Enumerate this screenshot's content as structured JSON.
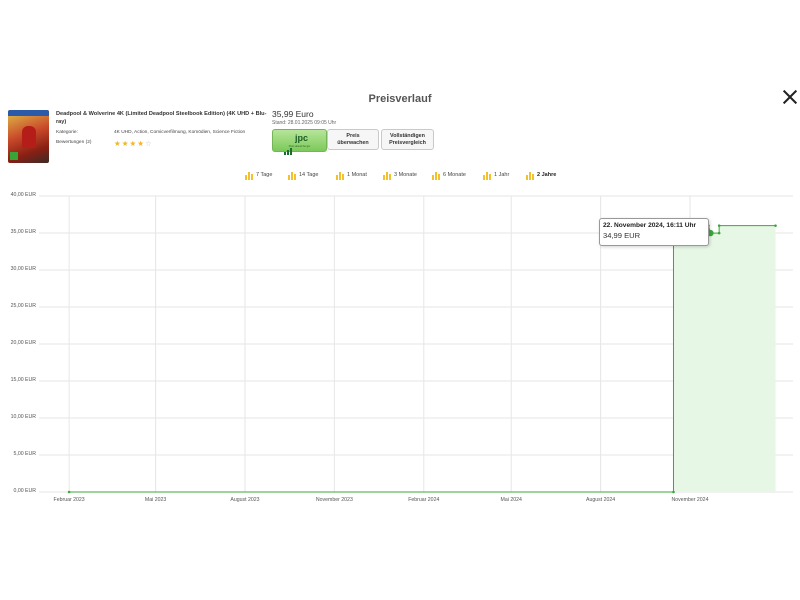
{
  "dialog": {
    "title": "Preisverlauf"
  },
  "product": {
    "title": "Deadpool & Wolverine 4K (Limited Deadpool Steelbook Edition) (4K UHD + Blu-ray)",
    "kategorie_label": "Kategorie:",
    "kategorie_value": "4K UHD, Action, Comicverfilmung, Komödien, Science Fiction",
    "bewertungen_label": "Bewertungen (2)",
    "rating_value": 4,
    "rating_max": 5,
    "price": "35,99 Euro",
    "stand": "Stand: 28.01.2025 09:05 Uhr"
  },
  "buttons": {
    "shop_logo": "jpc",
    "shop_sub": "Preis aktuell bei jpc",
    "watch_line1": "Preis",
    "watch_line2": "überwachen",
    "compare_line1": "Vollständigen",
    "compare_line2": "Preisvergleich"
  },
  "ranges": [
    {
      "label": "7 Tage",
      "active": false
    },
    {
      "label": "14 Tage",
      "active": false
    },
    {
      "label": "1 Monat",
      "active": false
    },
    {
      "label": "3 Monate",
      "active": false
    },
    {
      "label": "6 Monate",
      "active": false
    },
    {
      "label": "1 Jahr",
      "active": false
    },
    {
      "label": "2 Jahre",
      "active": true
    }
  ],
  "tooltip": {
    "date": "22. November 2024, 16:11 Uhr",
    "value": "34,99 EUR"
  },
  "colors": {
    "line": "#3aa83a",
    "fill": "#e6f7e6",
    "grid": "#e6e6e6",
    "star": "#f3b520",
    "range_icon": "#f3c12d"
  },
  "chart_data": {
    "type": "line",
    "series": [
      {
        "points": [
          {
            "x": "2023-02-01",
            "y": 0
          },
          {
            "x": "2024-10-15",
            "y": 0
          },
          {
            "x": "2024-10-15",
            "y": 35.99
          },
          {
            "x": "2024-11-20",
            "y": 35.99
          },
          {
            "x": "2024-11-22",
            "y": 34.99
          },
          {
            "x": "2024-12-01",
            "y": 34.99
          },
          {
            "x": "2024-12-01",
            "y": 35.99
          },
          {
            "x": "2025-01-28",
            "y": 35.99
          }
        ]
      }
    ],
    "highlight": {
      "x": "2024-11-22",
      "y": 34.99
    },
    "y_ticks": [
      "0,00 EUR",
      "5,00 EUR",
      "10,00 EUR",
      "15,00 EUR",
      "20,00 EUR",
      "25,00 EUR",
      "30,00 EUR",
      "35,00 EUR",
      "40,00 EUR"
    ],
    "y_tick_values": [
      0,
      5,
      10,
      15,
      20,
      25,
      30,
      35,
      40
    ],
    "x_ticks": [
      "Februar 2023",
      "Mai 2023",
      "August 2023",
      "November 2023",
      "Februar 2024",
      "Mai 2024",
      "August 2024",
      "November 2024"
    ],
    "x_tick_dates": [
      "2023-02-01",
      "2023-05-01",
      "2023-08-01",
      "2023-11-01",
      "2024-02-01",
      "2024-05-01",
      "2024-08-01",
      "2024-11-01"
    ],
    "ylim": [
      0,
      40
    ],
    "xlim": [
      "2023-01-01",
      "2025-02-15"
    ],
    "grid": true
  }
}
